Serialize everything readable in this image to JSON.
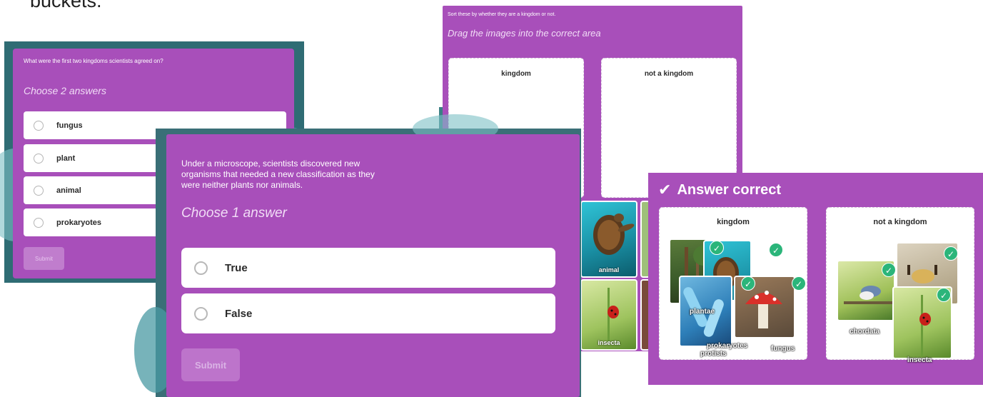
{
  "heading_fragment": "buckets.",
  "panel1": {
    "prompt": "What were the first two kingdoms scientists agreed on?",
    "instruction": "Choose 2 answers",
    "options": [
      "fungus",
      "plant",
      "animal",
      "prokaryotes"
    ],
    "submit": "Submit"
  },
  "panel2": {
    "prompt": "Under a microscope, scientists discovered new organisms that needed a new classification as they were neither plants nor animals.",
    "instruction": "Choose 1 answer",
    "options": [
      "True",
      "False"
    ],
    "submit": "Submit"
  },
  "panel3": {
    "prompt": "Sort these by whether they are a kingdom or not.",
    "instruction": "Drag the images into the correct area",
    "zones": [
      "kingdom",
      "not a kingdom"
    ],
    "tiles": [
      "animal",
      "insecta"
    ]
  },
  "panel4": {
    "status": "Answer correct",
    "zones": [
      "kingdom",
      "not a kingdom"
    ],
    "kingdom_labels": [
      "plantae",
      "prokaryotes",
      "protists",
      "fungus"
    ],
    "not_kingdom_labels": [
      "chordata",
      "insecta"
    ]
  },
  "colors": {
    "panel_purple": "#a84fba",
    "correct_green": "#2bb57a",
    "teal_background": "#2f6c74"
  }
}
